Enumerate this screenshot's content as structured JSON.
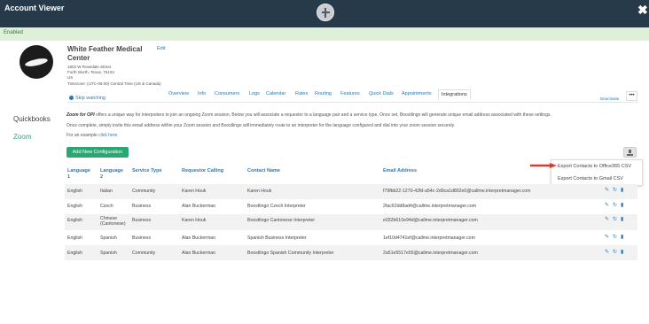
{
  "window": {
    "title": "Account Viewer",
    "close_glyph": "✖"
  },
  "status": {
    "text": "Enabled"
  },
  "org": {
    "name": "White Feather Medical Center",
    "edit": "Edit",
    "address_line1": "1802 W Rosedale Street",
    "address_line2": "Forth Worth, Texas, 76104",
    "country": "US",
    "timezone": "Timezone: (UTC-06:00) Central Time (US & Canada)"
  },
  "skip_watching": "Skip watching",
  "tabs": [
    "Overview",
    "Info",
    "Consumers",
    "Logs",
    "Calendar",
    "Rates",
    "Routing",
    "Features",
    "Quick Dials",
    "Appointments",
    "Integrations"
  ],
  "active_tab": "Integrations",
  "deactivate": "Deactivate",
  "more": "•••",
  "sidebar": {
    "items": [
      "Quickbooks",
      "Zoom"
    ]
  },
  "integration": {
    "intro_bold": "Zoom for OPI",
    "intro_rest": " offers a unique way for interpreters to join an ongoing Zoom session. Below you will associate a requestor to a language pair and a service type. Once set, Boostlingo will generate unique email address associated with these settings.",
    "line2": "Once complete, simply invite this email address within your Zoom session and Boostlingo will immediately route to an interpreter for the language configured and dial into your zoom session securely.",
    "example_prefix": "For an example ",
    "example_link": "click here."
  },
  "add_button": "Add New Configuration",
  "export_menu": [
    "Export Contacts to Office365 CSV",
    "Export Contacts to Gmail CSV"
  ],
  "table": {
    "headers": [
      "Language 1",
      "Language 2",
      "Service Type",
      "Requestor Calling",
      "Contact Name",
      "Email Address"
    ],
    "rows": [
      [
        "English",
        "Italian",
        "Community",
        "Karen Houk",
        "Karen Houk",
        "f79fbb22-1270-42fd-a54c-2d9ca1d802e0@callme.interpretmanager.com"
      ],
      [
        "English",
        "Czech",
        "Business",
        "Alan Buckerman",
        "Boostlingo Czech Interpreter",
        "2fac62dd8ad4@callme.interpretmanager.com"
      ],
      [
        "English",
        "Chinese (Cantonese)",
        "Business",
        "Karen Houk",
        "Boostlingo Cantonese Interpreter",
        "e032b610e94d@callme.interpretmanager.com"
      ],
      [
        "English",
        "Spanish",
        "Business",
        "Alan Buckerman",
        "Spanish Business Interpreter",
        "1ef10d4741ef@callme.interpretmanager.com"
      ],
      [
        "English",
        "Spanish",
        "Community",
        "Alan Buckerman",
        "Boostlingo Spanish Community Interpreter",
        "2a51e5517e55@callme.interpretmanager.com"
      ]
    ]
  },
  "colors": {
    "topbar": "#263a49",
    "accent_green": "#2aa873",
    "link_blue": "#2a7ab0",
    "arrow_red": "#d63b2f"
  }
}
